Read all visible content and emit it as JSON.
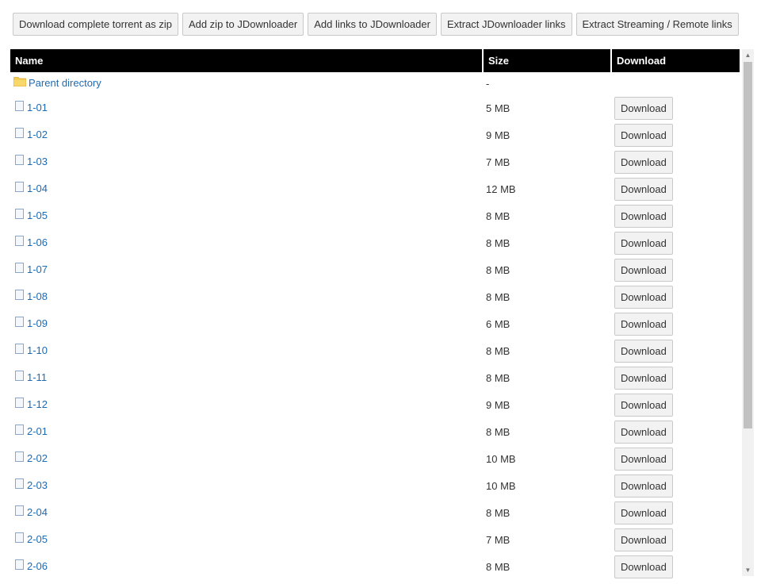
{
  "toolbar": {
    "download_zip": "Download complete torrent as zip",
    "add_zip_jd": "Add zip to JDownloader",
    "add_links_jd": "Add links to JDownloader",
    "extract_jd": "Extract JDownloader links",
    "extract_streaming": "Extract Streaming / Remote links"
  },
  "table": {
    "headers": {
      "name": "Name",
      "size": "Size",
      "download": "Download"
    },
    "parent": {
      "name": "Parent directory",
      "size": "-"
    },
    "download_label": "Download",
    "rows": [
      {
        "name": "1-01",
        "size": "5 MB"
      },
      {
        "name": "1-02",
        "size": "9 MB"
      },
      {
        "name": "1-03",
        "size": "7 MB"
      },
      {
        "name": "1-04",
        "size": "12 MB"
      },
      {
        "name": "1-05",
        "size": "8 MB"
      },
      {
        "name": "1-06",
        "size": "8 MB"
      },
      {
        "name": "1-07",
        "size": "8 MB"
      },
      {
        "name": "1-08",
        "size": "8 MB"
      },
      {
        "name": "1-09",
        "size": "6 MB"
      },
      {
        "name": "1-10",
        "size": "8 MB"
      },
      {
        "name": "1-11",
        "size": "8 MB"
      },
      {
        "name": "1-12",
        "size": "9 MB"
      },
      {
        "name": "2-01",
        "size": "8 MB"
      },
      {
        "name": "2-02",
        "size": "10 MB"
      },
      {
        "name": "2-03",
        "size": "10 MB"
      },
      {
        "name": "2-04",
        "size": "8 MB"
      },
      {
        "name": "2-05",
        "size": "7 MB"
      },
      {
        "name": "2-06",
        "size": "8 MB"
      }
    ]
  },
  "icons": {
    "folder": "folder-icon",
    "file": "file-icon",
    "scroll_up": "chevron-up-icon",
    "scroll_down": "chevron-down-icon"
  },
  "colors": {
    "link": "#1e6ab3",
    "header_bg": "#000000",
    "header_text": "#ffffff",
    "button_bg": "#f2f2f2"
  }
}
